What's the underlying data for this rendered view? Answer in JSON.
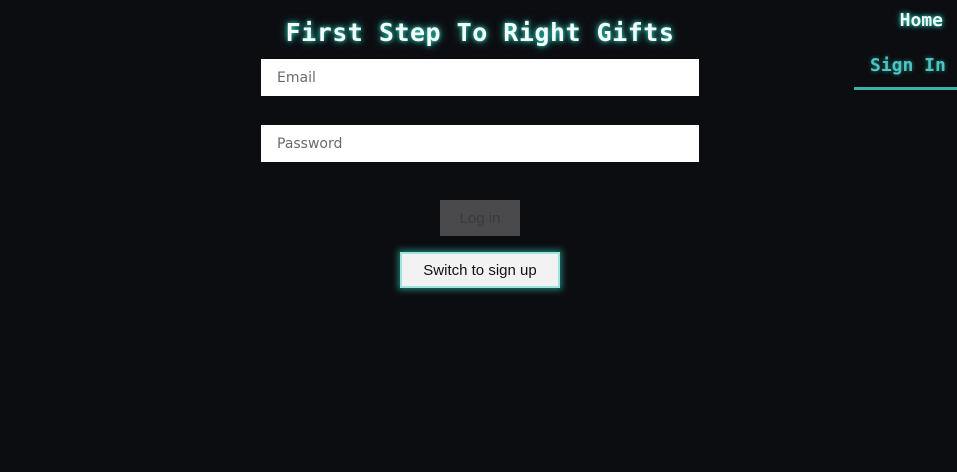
{
  "header": {
    "title": "First Step To Right Gifts"
  },
  "nav": {
    "home_label": "Home",
    "signin_label": "Sign In",
    "active": "Sign In"
  },
  "form": {
    "email": {
      "value": "",
      "placeholder": "Email"
    },
    "password": {
      "value": "",
      "placeholder": "Password"
    },
    "login_label": "Log in",
    "login_enabled": false,
    "switch_label": "Switch to sign up"
  },
  "colors": {
    "background": "#0c0d11",
    "accent": "#3cb0aa",
    "glow": "#2dd4bf",
    "disabled_button": "#4a4a4c"
  }
}
